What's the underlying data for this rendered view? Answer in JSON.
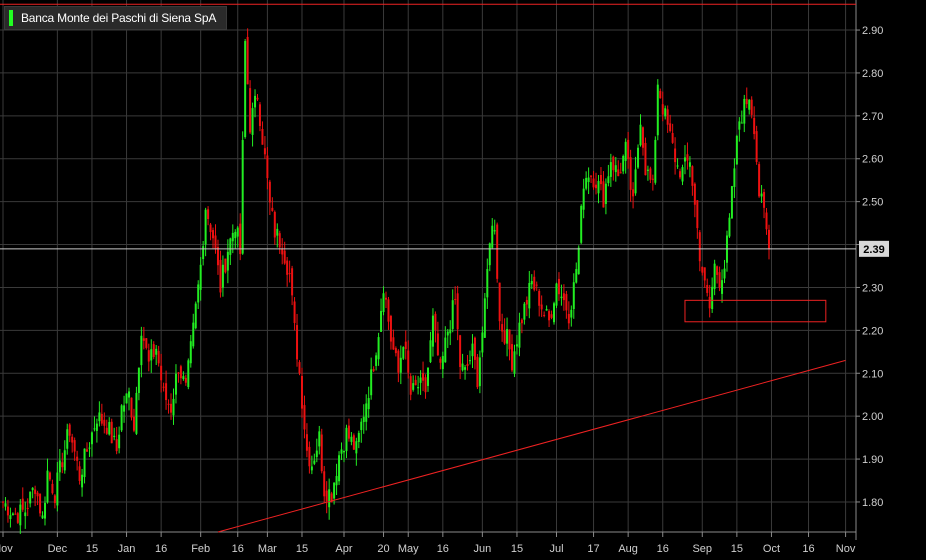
{
  "chart_data": {
    "type": "candlestick",
    "title": "Banca Monte dei Paschi di Siena SpA",
    "last_price_label": "2.39",
    "last_price": 2.39,
    "y_ticks": [
      "1.80",
      "1.90",
      "2.00",
      "2.10",
      "2.20",
      "2.30",
      "2.40",
      "2.50",
      "2.60",
      "2.70",
      "2.80",
      "2.90"
    ],
    "ylim": [
      1.73,
      2.97
    ],
    "x_ticks": [
      {
        "label": "Nov",
        "i": 0
      },
      {
        "label": "Dec",
        "i": 22
      },
      {
        "label": "15",
        "i": 36
      },
      {
        "label": "Jan",
        "i": 50
      },
      {
        "label": "16",
        "i": 64
      },
      {
        "label": "Feb",
        "i": 80
      },
      {
        "label": "16",
        "i": 95
      },
      {
        "label": "Mar",
        "i": 107
      },
      {
        "label": "15",
        "i": 121
      },
      {
        "label": "Apr",
        "i": 138
      },
      {
        "label": "20",
        "i": 154
      },
      {
        "label": "May",
        "i": 164
      },
      {
        "label": "16",
        "i": 178
      },
      {
        "label": "Jun",
        "i": 194
      },
      {
        "label": "15",
        "i": 208
      },
      {
        "label": "Jul",
        "i": 224
      },
      {
        "label": "17",
        "i": 239
      },
      {
        "label": "Aug",
        "i": 253
      },
      {
        "label": "16",
        "i": 267
      },
      {
        "label": "Sep",
        "i": 283
      },
      {
        "label": "15",
        "i": 297
      },
      {
        "label": "Oct",
        "i": 311
      },
      {
        "label": "16",
        "i": 326
      },
      {
        "label": "Nov",
        "i": 341
      }
    ],
    "x_count": 345,
    "closes": [
      [
        0,
        1.8
      ],
      [
        5,
        1.77
      ],
      [
        9,
        1.78
      ],
      [
        13,
        1.84
      ],
      [
        16,
        1.76
      ],
      [
        18,
        1.87
      ],
      [
        21,
        1.82
      ],
      [
        24,
        1.9
      ],
      [
        27,
        1.97
      ],
      [
        31,
        1.86
      ],
      [
        35,
        1.94
      ],
      [
        38,
        2.0
      ],
      [
        42,
        1.98
      ],
      [
        46,
        1.92
      ],
      [
        48,
        2.02
      ],
      [
        51,
        2.05
      ],
      [
        53,
        1.98
      ],
      [
        56,
        2.21
      ],
      [
        59,
        2.12
      ],
      [
        62,
        2.16
      ],
      [
        65,
        2.05
      ],
      [
        68,
        2.02
      ],
      [
        71,
        2.12
      ],
      [
        74,
        2.06
      ],
      [
        77,
        2.2
      ],
      [
        80,
        2.35
      ],
      [
        82,
        2.49
      ],
      [
        85,
        2.42
      ],
      [
        88,
        2.3
      ],
      [
        91,
        2.39
      ],
      [
        94,
        2.45
      ],
      [
        96,
        2.38
      ],
      [
        98,
        2.87
      ],
      [
        100,
        2.68
      ],
      [
        103,
        2.75
      ],
      [
        106,
        2.6
      ],
      [
        108,
        2.49
      ],
      [
        110,
        2.43
      ],
      [
        113,
        2.4
      ],
      [
        116,
        2.33
      ],
      [
        118,
        2.2
      ],
      [
        120,
        2.1
      ],
      [
        123,
        1.92
      ],
      [
        125,
        1.89
      ],
      [
        128,
        1.95
      ],
      [
        130,
        1.83
      ],
      [
        133,
        1.82
      ],
      [
        136,
        1.91
      ],
      [
        139,
        1.96
      ],
      [
        141,
        1.94
      ],
      [
        143,
        1.92
      ],
      [
        146,
        2.01
      ],
      [
        149,
        2.09
      ],
      [
        152,
        2.2
      ],
      [
        154,
        2.31
      ],
      [
        157,
        2.18
      ],
      [
        160,
        2.1
      ],
      [
        162,
        2.18
      ],
      [
        165,
        2.05
      ],
      [
        168,
        2.07
      ],
      [
        171,
        2.06
      ],
      [
        174,
        2.22
      ],
      [
        177,
        2.1
      ],
      [
        180,
        2.2
      ],
      [
        183,
        2.27
      ],
      [
        185,
        2.12
      ],
      [
        187,
        2.1
      ],
      [
        190,
        2.15
      ],
      [
        192,
        2.09
      ],
      [
        195,
        2.25
      ],
      [
        197,
        2.42
      ],
      [
        199,
        2.45
      ],
      [
        201,
        2.22
      ],
      [
        204,
        2.18
      ],
      [
        206,
        2.13
      ],
      [
        209,
        2.21
      ],
      [
        212,
        2.27
      ],
      [
        214,
        2.31
      ],
      [
        216,
        2.29
      ],
      [
        219,
        2.24
      ],
      [
        221,
        2.22
      ],
      [
        224,
        2.31
      ],
      [
        227,
        2.27
      ],
      [
        229,
        2.24
      ],
      [
        231,
        2.3
      ],
      [
        233,
        2.39
      ],
      [
        235,
        2.55
      ],
      [
        237,
        2.57
      ],
      [
        240,
        2.55
      ],
      [
        243,
        2.51
      ],
      [
        246,
        2.6
      ],
      [
        249,
        2.56
      ],
      [
        252,
        2.62
      ],
      [
        255,
        2.49
      ],
      [
        258,
        2.7
      ],
      [
        260,
        2.58
      ],
      [
        263,
        2.53
      ],
      [
        265,
        2.78
      ],
      [
        267,
        2.72
      ],
      [
        270,
        2.65
      ],
      [
        273,
        2.58
      ],
      [
        275,
        2.57
      ],
      [
        278,
        2.6
      ],
      [
        280,
        2.49
      ],
      [
        282,
        2.38
      ],
      [
        284,
        2.3
      ],
      [
        286,
        2.25
      ],
      [
        288,
        2.35
      ],
      [
        290,
        2.32
      ],
      [
        292,
        2.35
      ],
      [
        294,
        2.45
      ],
      [
        296,
        2.58
      ],
      [
        298,
        2.69
      ],
      [
        300,
        2.72
      ],
      [
        302,
        2.75
      ],
      [
        304,
        2.68
      ],
      [
        306,
        2.52
      ],
      [
        308,
        2.47
      ],
      [
        310,
        2.39
      ]
    ],
    "annotations": [
      {
        "type": "horizontal-line",
        "value": 2.96
      },
      {
        "type": "horizontal-line",
        "value": 2.39
      },
      {
        "type": "trendline",
        "from": [
          87,
          1.73
        ],
        "to": [
          341,
          2.13
        ]
      },
      {
        "type": "box",
        "x_from": 276,
        "x_to": 333,
        "y_from": 2.22,
        "y_to": 2.27
      }
    ],
    "colors": {
      "up": "#22ee22",
      "down": "#ee1111",
      "grid": "#3a3a3a",
      "axis_text": "#cfcfcf",
      "annotation": "#ee2222",
      "price_line": "#c8c8c8"
    },
    "legend": "top-left",
    "grid": true
  },
  "legend": {
    "label": "Banca Monte dei Paschi di Siena SpA"
  },
  "price_tag": {
    "label": "2.39"
  }
}
